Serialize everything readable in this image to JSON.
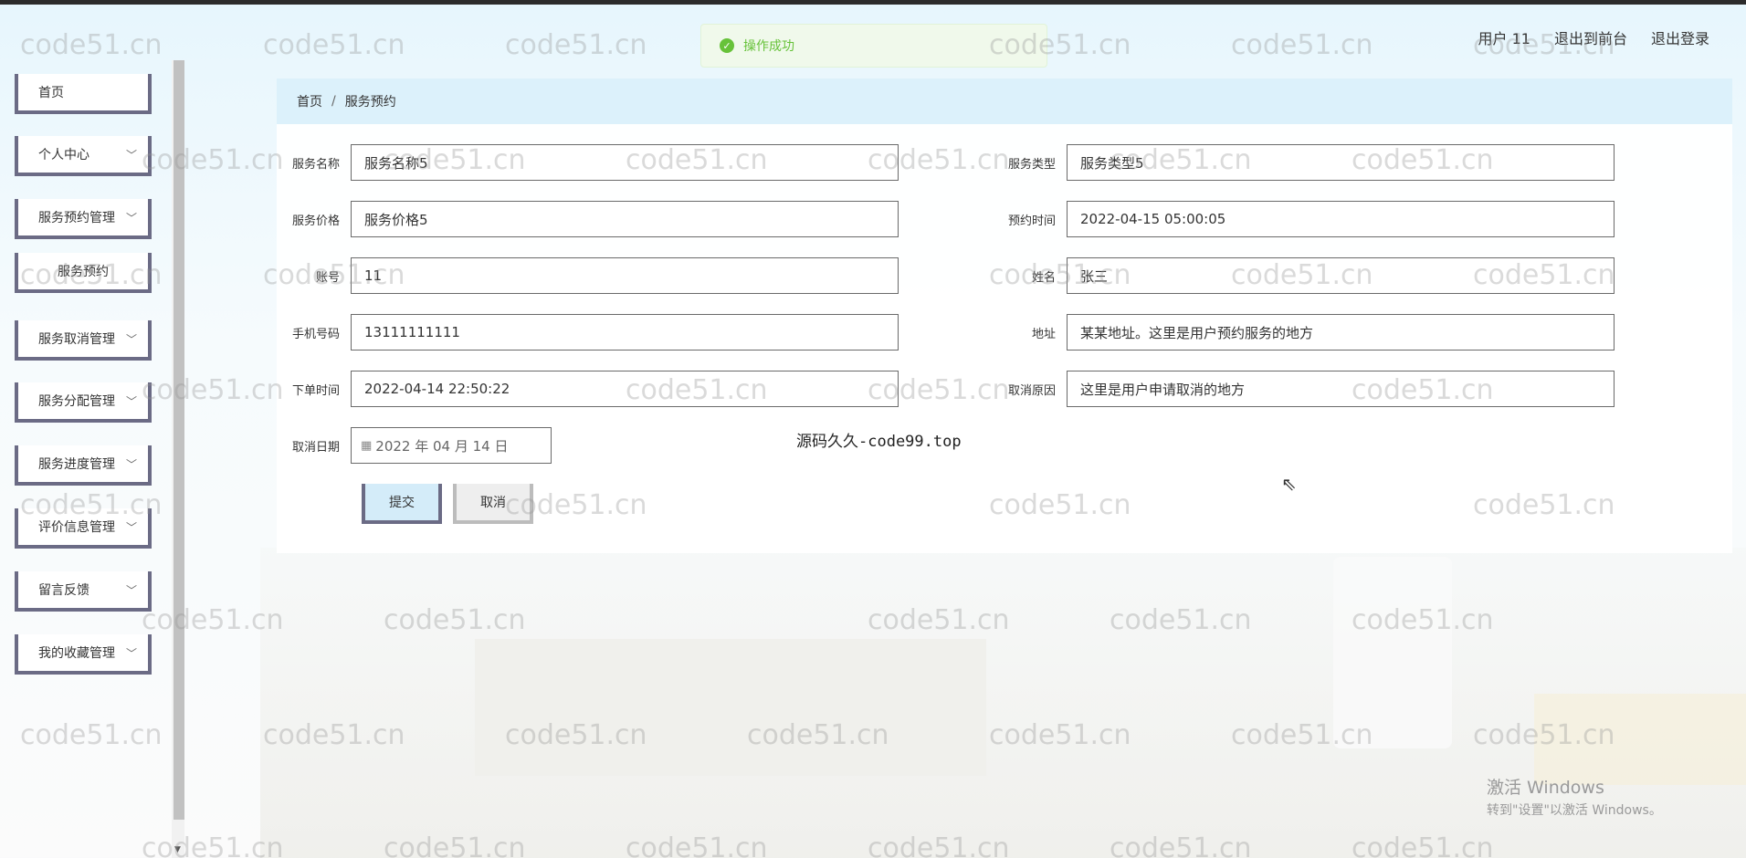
{
  "header": {
    "title": "",
    "user_label": "用户 11",
    "to_front_label": "退出到前台",
    "logout_label": "退出登录"
  },
  "toast": {
    "message": "操作成功"
  },
  "sidebar": {
    "items": [
      {
        "label": "首页"
      },
      {
        "label": "个人中心"
      },
      {
        "label": "服务预约管理"
      },
      {
        "label": "服务预约"
      },
      {
        "label": "服务取消管理"
      },
      {
        "label": "服务分配管理"
      },
      {
        "label": "服务进度管理"
      },
      {
        "label": "评价信息管理"
      },
      {
        "label": "留言反馈"
      },
      {
        "label": "我的收藏管理"
      }
    ]
  },
  "breadcrumb": {
    "home": "首页",
    "separator": "/",
    "current": "服务预约"
  },
  "form": {
    "service_name": {
      "label": "服务名称",
      "value": "服务名称5"
    },
    "service_type": {
      "label": "服务类型",
      "value": "服务类型5"
    },
    "service_price": {
      "label": "服务价格",
      "value": "服务价格5"
    },
    "appointment_time": {
      "label": "预约时间",
      "value": "2022-04-15 05:00:05"
    },
    "account": {
      "label": "账号",
      "value": "11"
    },
    "name": {
      "label": "姓名",
      "value": "张三"
    },
    "phone": {
      "label": "手机号码",
      "value": "13111111111"
    },
    "address": {
      "label": "地址",
      "value": "某某地址。这里是用户预约服务的地方"
    },
    "order_time": {
      "label": "下单时间",
      "value": "2022-04-14 22:50:22"
    },
    "cancel_reason": {
      "label": "取消原因",
      "value": "这里是用户申请取消的地方"
    },
    "cancel_date": {
      "label": "取消日期",
      "value": "2022 年 04 月 14 日"
    },
    "submit_label": "提交",
    "cancel_label": "取消"
  },
  "overlay": {
    "source_text": "源码久久-code99.top",
    "watermark": "code51.cn",
    "windows_line1": "激活 Windows",
    "windows_line2": "转到\"设置\"以激活 Windows。"
  },
  "colors": {
    "accent": "#6b6b85",
    "breadcrumb_bg": "#dcf1fb",
    "submit_bg": "#d4ecf9",
    "toast_green": "#67c23a"
  }
}
